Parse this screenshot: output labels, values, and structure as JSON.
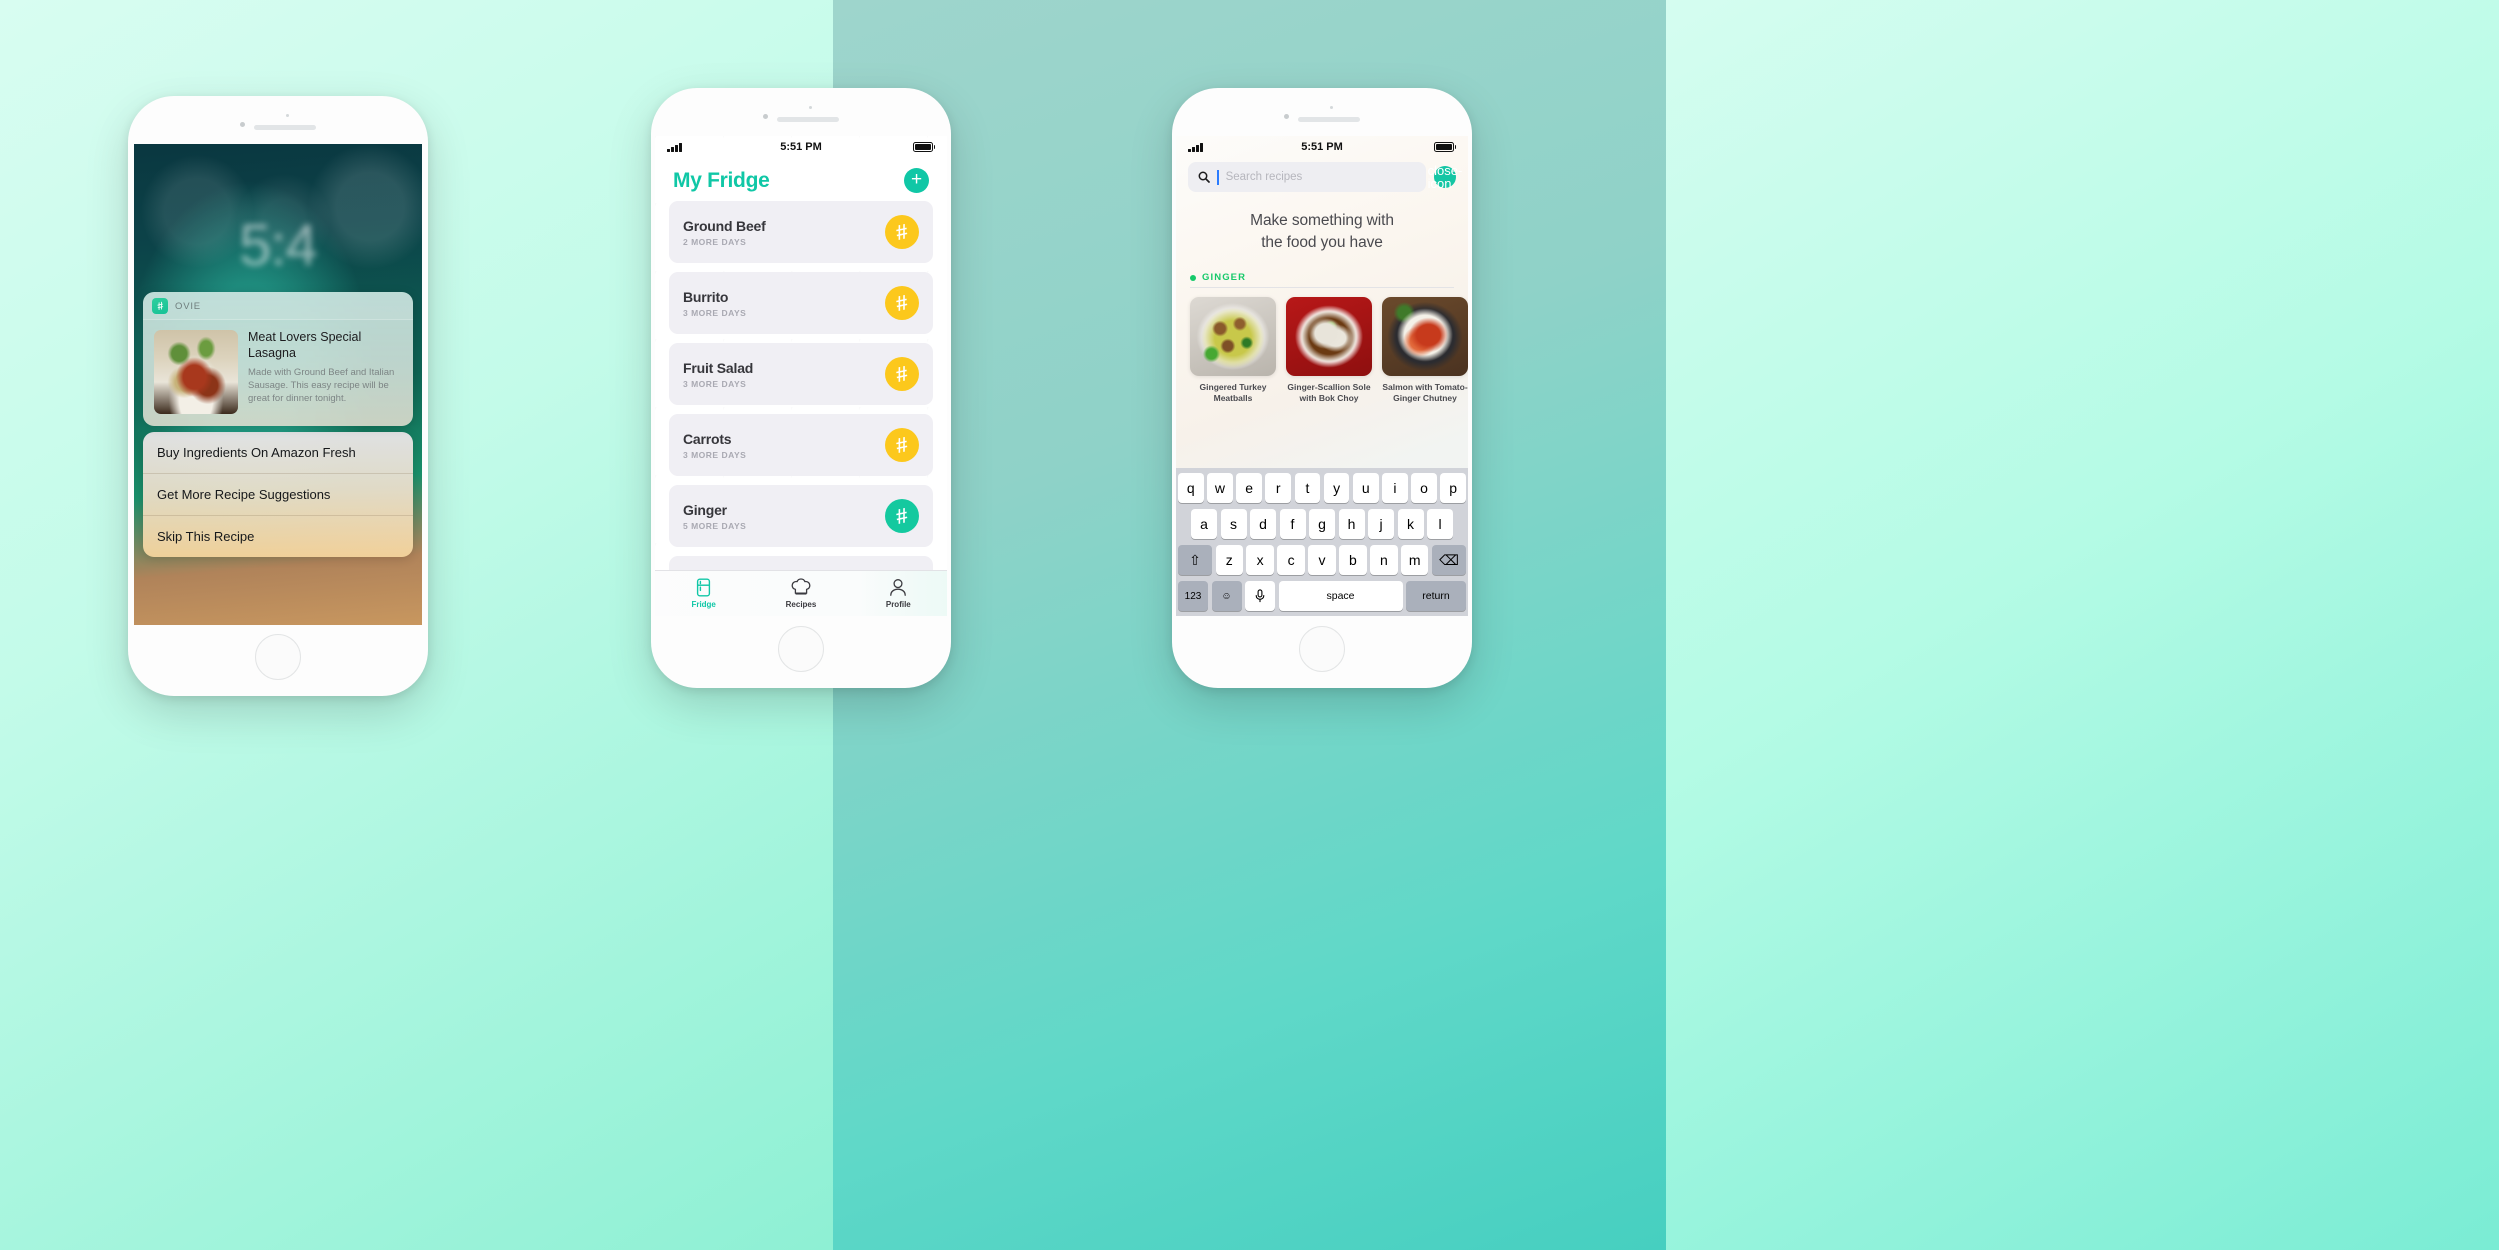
{
  "background": {
    "panel_left_color": "#c3fbe9",
    "panel_mid_color": "#8fd2c8",
    "panel_right_color": "#b4fbe5",
    "accent_teal": "#10c7a6",
    "accent_yellow": "#fcc81c",
    "accent_green": "#16c96a"
  },
  "phone1": {
    "lockscreen": {
      "time": "5:4",
      "date": "",
      "notification": {
        "app_icon": "hash-icon",
        "app_name": "OVIE",
        "title": "Meat Lovers Special Lasagna",
        "description": "Made with Ground Beef and Italian Sausage. This easy recipe will be great for dinner tonight.",
        "thumb_icon": "lasagna-photo"
      },
      "actions": [
        {
          "label": "Buy Ingredients On Amazon Fresh"
        },
        {
          "label": "Get More Recipe Suggestions"
        },
        {
          "label": "Skip This Recipe"
        }
      ]
    }
  },
  "phone2": {
    "status": {
      "time": "5:51 PM",
      "signal_icon": "signal-bars-icon",
      "battery_icon": "battery-full-icon"
    },
    "header": {
      "title": "My Fridge",
      "add_label": "+"
    },
    "items": [
      {
        "name": "Ground Beef",
        "days": "2 MORE DAYS",
        "badge": "hash-icon",
        "badge_color": "yellow"
      },
      {
        "name": "Burrito",
        "days": "3 MORE DAYS",
        "badge": "hash-icon",
        "badge_color": "yellow"
      },
      {
        "name": "Fruit Salad",
        "days": "3 MORE DAYS",
        "badge": "hash-icon",
        "badge_color": "yellow"
      },
      {
        "name": "Carrots",
        "days": "3 MORE DAYS",
        "badge": "hash-icon",
        "badge_color": "yellow"
      },
      {
        "name": "Ginger",
        "days": "5 MORE DAYS",
        "badge": "hash-icon",
        "badge_color": "teal"
      }
    ],
    "tabs": [
      {
        "label": "Fridge",
        "icon": "refrigerator-icon",
        "active": true
      },
      {
        "label": "Recipes",
        "icon": "chef-hat-icon",
        "active": false
      },
      {
        "label": "Profile",
        "icon": "person-icon",
        "active": false
      }
    ]
  },
  "phone3": {
    "status": {
      "time": "5:51 PM",
      "signal_icon": "signal-bars-icon",
      "battery_icon": "battery-full-icon"
    },
    "search": {
      "placeholder": "Search recipes",
      "value": "",
      "icon": "search-icon",
      "close_icon": "close-icon"
    },
    "hero": {
      "line1": "Make something with",
      "line2": "the food you have"
    },
    "section": {
      "label": "GINGER",
      "dot_color": "#16c96a"
    },
    "recipes": [
      {
        "title": "Gingered Turkey Meatballs",
        "image": "meatball-soup-photo"
      },
      {
        "title": "Ginger-Scallion Sole with Bok Choy",
        "image": "sole-dish-photo"
      },
      {
        "title": "Salmon with Tomato-Ginger Chutney",
        "image": "salmon-rice-photo"
      }
    ],
    "keyboard": {
      "row1": [
        "q",
        "w",
        "e",
        "r",
        "t",
        "y",
        "u",
        "i",
        "o",
        "p"
      ],
      "row2": [
        "a",
        "s",
        "d",
        "f",
        "g",
        "h",
        "j",
        "k",
        "l"
      ],
      "row3": [
        "z",
        "x",
        "c",
        "v",
        "b",
        "n",
        "m"
      ],
      "shift": "⇧",
      "backspace": "⌫",
      "numbers": "123",
      "emoji": "☺",
      "mic": "🎤",
      "space": "space",
      "return": "return"
    }
  }
}
